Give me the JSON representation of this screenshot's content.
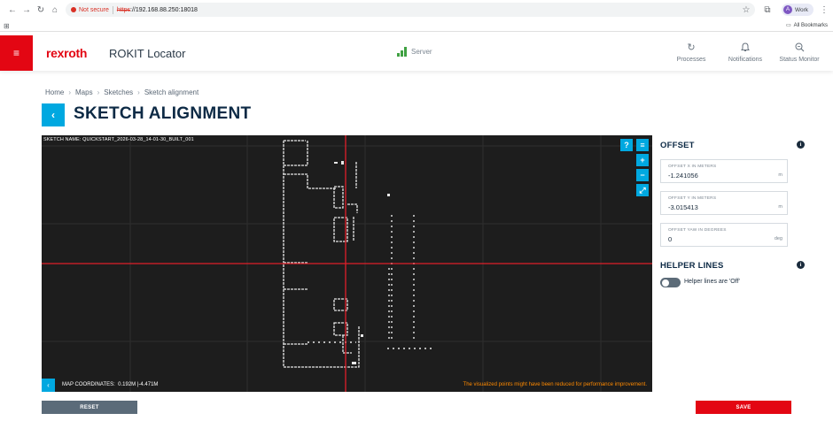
{
  "browser": {
    "security_label": "Not secure",
    "url_protocol": "https",
    "url_rest": "://192.168.88.250:18018",
    "profile_initial": "A",
    "profile_label": "Work",
    "all_bookmarks": "All Bookmarks"
  },
  "header": {
    "brand": "rexroth",
    "app_name": "ROKIT Locator",
    "server_label": "Server",
    "actions": [
      {
        "label": "Processes",
        "icon": "refresh-icon"
      },
      {
        "label": "Notifications",
        "icon": "bell-icon"
      },
      {
        "label": "Status Monitor",
        "icon": "status-search-icon"
      }
    ]
  },
  "breadcrumb": [
    "Home",
    "Maps",
    "Sketches",
    "Sketch alignment"
  ],
  "page": {
    "title": "SKETCH ALIGNMENT"
  },
  "map": {
    "sketch_label": "SKETCH NAME:   QUICKSTART_2026-03-28_14-01-30_BUILT_001",
    "coords_label": "MAP COORDINATES:",
    "coords_x": "0.192M",
    "coords_y": "-4.471M",
    "note": "The visualized points might have been reduced for performance improvement.",
    "tools": [
      {
        "glyph": "?",
        "icon": "help-icon"
      },
      {
        "glyph": "≡",
        "icon": "layers-icon"
      },
      {
        "glyph": "+",
        "icon": "zoom-in-icon"
      },
      {
        "glyph": "−",
        "icon": "zoom-out-icon"
      },
      {
        "glyph": "⤢",
        "icon": "fit-icon"
      }
    ]
  },
  "offset": {
    "title": "OFFSET",
    "x": {
      "label": "OFFSET X IN METERS",
      "value": "-1.241056",
      "unit": "m"
    },
    "y": {
      "label": "OFFSET Y IN METERS",
      "value": "-3.015413",
      "unit": "m"
    },
    "yaw": {
      "label": "OFFSET YAW IN DEGREES",
      "value": "0",
      "unit": "deg"
    }
  },
  "helper_lines": {
    "title": "HELPER LINES",
    "toggle_label": "Helper lines are 'Off'",
    "enabled": false
  },
  "buttons": {
    "reset": "RESET",
    "save": "SAVE"
  },
  "colors": {
    "accent": "#00a8e0",
    "brand_red": "#e30613",
    "map_bg": "#1d1d1d",
    "crosshair": "#e0202a"
  }
}
